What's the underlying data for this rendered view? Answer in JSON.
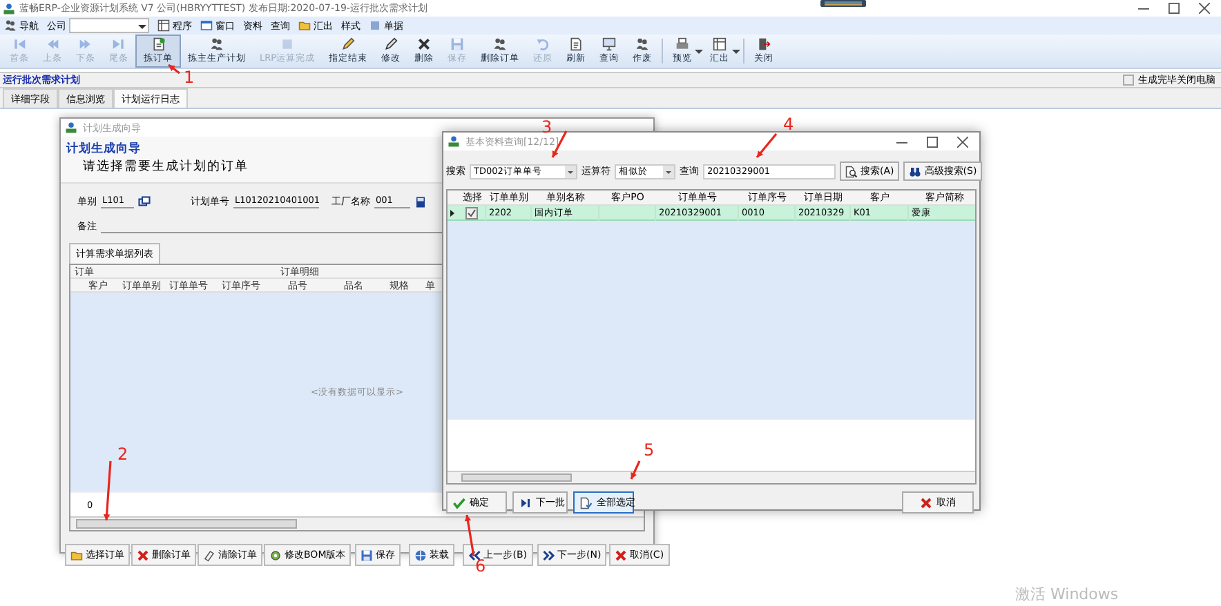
{
  "app_window": {
    "title": "蓝畅ERP-企业资源计划系统 V7 公司(HBRYYTTEST) 发布日期:2020-07-19-运行批次需求计划"
  },
  "menu": {
    "items": [
      {
        "label": "导航"
      },
      {
        "label": "公司"
      },
      {
        "label": "程序"
      },
      {
        "label": "窗口"
      },
      {
        "label": "资料"
      },
      {
        "label": "查询"
      },
      {
        "label": "汇出"
      },
      {
        "label": "样式"
      },
      {
        "label": "单据"
      }
    ]
  },
  "toolbar": [
    {
      "label": "首条",
      "disabled": true,
      "pressed": false,
      "dropdown": false
    },
    {
      "label": "上条",
      "disabled": true,
      "pressed": false,
      "dropdown": false
    },
    {
      "label": "下条",
      "disabled": true,
      "pressed": false,
      "dropdown": false
    },
    {
      "label": "尾条",
      "disabled": true,
      "pressed": false,
      "dropdown": false
    },
    {
      "label": "拣订单",
      "disabled": false,
      "pressed": true,
      "dropdown": false
    },
    {
      "label": "拣主生产计划",
      "disabled": false,
      "pressed": false,
      "dropdown": false
    },
    {
      "label": "LRP运算完成",
      "disabled": true,
      "pressed": false,
      "dropdown": false
    },
    {
      "label": "指定结束",
      "disabled": false,
      "pressed": false,
      "dropdown": false
    },
    {
      "label": "修改",
      "disabled": false,
      "pressed": false,
      "dropdown": false
    },
    {
      "label": "删除",
      "disabled": false,
      "pressed": false,
      "dropdown": false
    },
    {
      "label": "保存",
      "disabled": true,
      "pressed": false,
      "dropdown": false
    },
    {
      "label": "删除订单",
      "disabled": false,
      "pressed": false,
      "dropdown": false
    },
    {
      "label": "还原",
      "disabled": true,
      "pressed": false,
      "dropdown": false
    },
    {
      "label": "刷新",
      "disabled": false,
      "pressed": false,
      "dropdown": false
    },
    {
      "label": "查询",
      "disabled": false,
      "pressed": false,
      "dropdown": false
    },
    {
      "label": "作废",
      "disabled": false,
      "pressed": false,
      "dropdown": false
    },
    {
      "label": "预览",
      "disabled": false,
      "pressed": false,
      "dropdown": true
    },
    {
      "label": "汇出",
      "disabled": false,
      "pressed": false,
      "dropdown": true
    },
    {
      "label": "关闭",
      "disabled": false,
      "pressed": false,
      "dropdown": false
    }
  ],
  "section_title": "运行批次需求计划",
  "close_pc_checkbox": {
    "label": "生成完毕关闭电脑",
    "checked": false
  },
  "tabs": [
    {
      "label": "详细字段",
      "selected": false
    },
    {
      "label": "信息浏览",
      "selected": false
    },
    {
      "label": "计划运行日志",
      "selected": true
    }
  ],
  "wizard_dialog": {
    "title": "计划生成向导",
    "heading": "计划生成向导",
    "subheading": "请选择需要生成计划的订单",
    "fields": [
      {
        "label": "单别",
        "value": "L101"
      },
      {
        "label": "计划单号",
        "value": "L10120210401001"
      },
      {
        "label": "工厂名称",
        "value": "001"
      }
    ],
    "remark_label": "备注",
    "tab": "计算需求单据列表",
    "column_groups": [
      "订单",
      "订单明细"
    ],
    "columns": [
      "客户",
      "订单单别",
      "订单单号",
      "订单序号",
      "品号",
      "品名",
      "规格",
      "单"
    ],
    "empty_text": "<没有数据可以显示>",
    "footer_count": "0",
    "buttons": [
      "选择订单",
      "删除订单",
      "清除订单",
      "修改BOM版本",
      "保存",
      "装载",
      "上一步(B)",
      "下一步(N)",
      "取消(C)"
    ]
  },
  "query_dialog": {
    "title": "基本资料查询[12/12]",
    "search_label": "搜索",
    "search_field": "TD002订单单号",
    "operator_label": "运算符",
    "operator": "相似於",
    "query_label": "查询",
    "query_value": "20210329001",
    "search_buttons": [
      "搜索(A)",
      "高级搜索(S)"
    ],
    "select_header": "选择",
    "columns": [
      "订单单别",
      "单别名称",
      "客户PO",
      "订单单号",
      "订单序号",
      "订单日期",
      "客户",
      "客户简称"
    ],
    "rows": [
      {
        "selected": true,
        "checked": true,
        "cells": [
          "2202",
          "国内订单",
          "",
          "20210329001",
          "0010",
          "20210329",
          "K01",
          "爱康"
        ]
      }
    ],
    "buttons": [
      {
        "label": "确定",
        "focused": false
      },
      {
        "label": "下一批",
        "focused": false
      },
      {
        "label": "全部选定",
        "focused": true
      },
      {
        "label": "取消",
        "focused": false
      }
    ]
  },
  "annotations": [
    "1",
    "2",
    "3",
    "4",
    "5",
    "6"
  ],
  "os_notice": "激活 Windows"
}
